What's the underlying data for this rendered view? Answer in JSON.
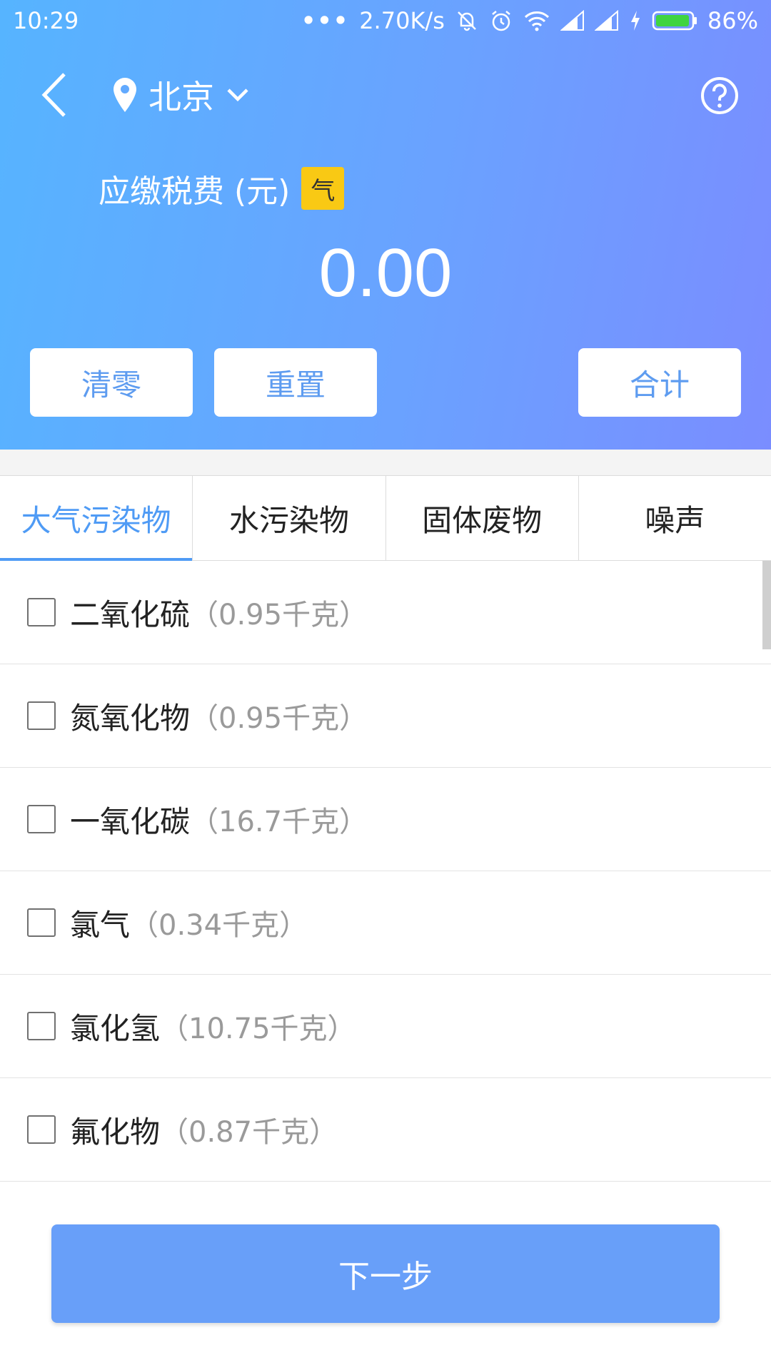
{
  "status_bar": {
    "time": "10:29",
    "dots": "•••",
    "speed": "2.70K/s",
    "battery": "86%"
  },
  "nav": {
    "city": "北京"
  },
  "amount": {
    "label": "应缴税费 (元)",
    "badge": "气",
    "value": "0.00"
  },
  "buttons": {
    "clear": "清零",
    "reset": "重置",
    "total": "合计"
  },
  "tabs": [
    "大气污染物",
    "水污染物",
    "固体废物",
    "噪声"
  ],
  "items": [
    {
      "name": "二氧化硫",
      "amount": "（0.95千克）"
    },
    {
      "name": "氮氧化物",
      "amount": "（0.95千克）"
    },
    {
      "name": "一氧化碳",
      "amount": "（16.7千克）"
    },
    {
      "name": "氯气",
      "amount": "（0.34千克）"
    },
    {
      "name": "氯化氢",
      "amount": "（10.75千克）"
    },
    {
      "name": "氟化物",
      "amount": "（0.87千克）"
    }
  ],
  "next_label": "下一步",
  "colors": {
    "accent": "#4f9bf5",
    "badge": "#f9c914",
    "next_button": "#689ff9"
  }
}
